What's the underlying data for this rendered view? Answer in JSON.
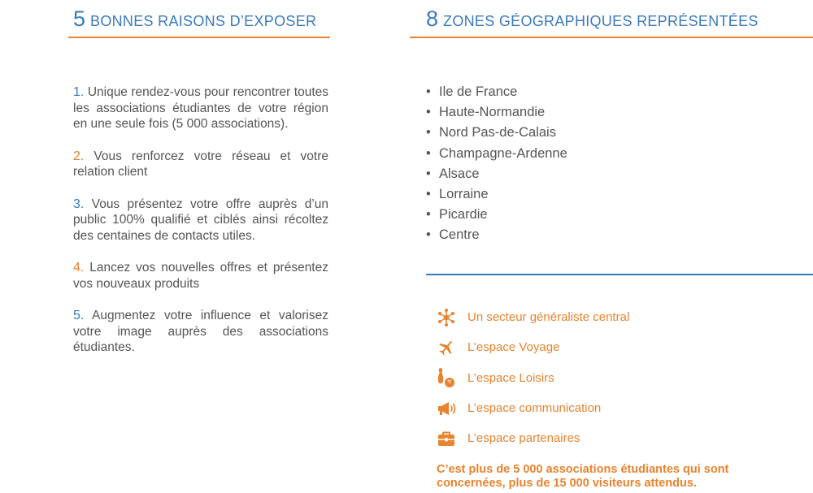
{
  "colors": {
    "accent_blue": "#3a7bbd",
    "accent_orange": "#e8832f",
    "body_text": "#555555"
  },
  "left": {
    "heading": {
      "number": "5",
      "text": "BONNES RAISONS D’EXPOSER"
    },
    "reasons": [
      {
        "number": "1.",
        "number_color": "#3a7bbd",
        "text": " Unique rendez-vous pour rencontrer toutes les associations étudiantes de votre région en une seule fois (5 000 associations)."
      },
      {
        "number": "2.",
        "number_color": "#e8832f",
        "text": " Vous renforcez votre réseau et votre relation client"
      },
      {
        "number": "3.",
        "number_color": "#3a7bbd",
        "text": " Vous présentez votre offre auprès d’un public 100% qualifié et ciblés ainsi récoltez des centaines de contacts utiles."
      },
      {
        "number": "4.",
        "number_color": "#e8832f",
        "text": " Lancez vos nouvelles offres et présentez vos nouveaux produits"
      },
      {
        "number": "5.",
        "number_color": "#3a7bbd",
        "text": " Augmentez votre influence et valorisez votre image auprès des associations étudiantes."
      }
    ]
  },
  "right": {
    "heading": {
      "number": "8",
      "text": "ZONES GÉOGRAPHIQUES REPRÉSENTÉES"
    },
    "bullet": "•",
    "zones": [
      "Ile de France",
      "Haute-Normandie",
      "Nord Pas-de-Calais",
      "Champagne-Ardenne",
      "Alsace",
      "Lorraine",
      "Picardie",
      "Centre"
    ],
    "spaces": [
      {
        "label": "Un secteur généraliste central",
        "icon": "network-icon"
      },
      {
        "label": "L’espace Voyage",
        "icon": "airplane-icon"
      },
      {
        "label": "L’espace Loisirs",
        "icon": "bowling-icon"
      },
      {
        "label": "L’espace communication",
        "icon": "megaphone-icon"
      },
      {
        "label": "L’espace partenaires",
        "icon": "briefcase-icon"
      }
    ],
    "note": "C’est plus de 5 000 associations étudiantes qui sont concernées, plus de 15 000 visiteurs attendus."
  }
}
